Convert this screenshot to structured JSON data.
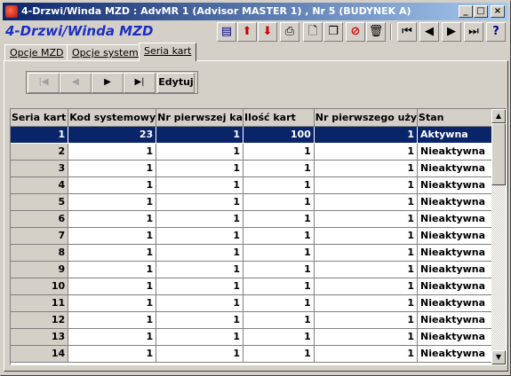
{
  "window": {
    "title": "4-Drzwi/Winda MZD : AdvMR 1 (Advisor MASTER 1) , Nr 5 (BUDYNEK A)",
    "buttons": {
      "minimize": "_",
      "maximize": "□",
      "close": "×"
    }
  },
  "app": {
    "label": "4-Drzwi/Winda MZD"
  },
  "toolbar": {
    "icons": [
      "filter-icon",
      "arrow-up-icon",
      "arrow-down-icon",
      "print-icon",
      "new-document-icon",
      "copy-icon",
      "no-entry-icon",
      "trash-icon",
      "first-record-icon",
      "previous-record-icon",
      "next-record-icon",
      "last-record-icon",
      "help-icon"
    ],
    "glyphs": {
      "up": "⬆",
      "down": "⬇",
      "print": "⎙",
      "new": "🗋",
      "copy": "❐",
      "stop": "⊘",
      "trash": "🗑",
      "first": "⏮",
      "prev": "◀",
      "next": "▶",
      "last": "⏭",
      "help": "?",
      "filter": "▤"
    },
    "colors": {
      "red": "#d40000",
      "navy": "#000080"
    }
  },
  "tabs": [
    {
      "label": "Opcje MZD"
    },
    {
      "label": "Opcje systemu"
    },
    {
      "label": "Seria kart",
      "active": true
    }
  ],
  "nav": {
    "first": "|◀",
    "prev": "◀",
    "next": "▶",
    "last": "▶|",
    "edit": "Edytuj"
  },
  "grid": {
    "columns": [
      "Seria kart",
      "Kod systemowy",
      "Nr pierwszej ka",
      "Ilość kart",
      "Nr pierwszego uży",
      "Stan"
    ],
    "rows": [
      [
        "1",
        "23",
        "1",
        "100",
        "1",
        "Aktywna"
      ],
      [
        "2",
        "1",
        "1",
        "1",
        "1",
        "Nieaktywna"
      ],
      [
        "3",
        "1",
        "1",
        "1",
        "1",
        "Nieaktywna"
      ],
      [
        "4",
        "1",
        "1",
        "1",
        "1",
        "Nieaktywna"
      ],
      [
        "5",
        "1",
        "1",
        "1",
        "1",
        "Nieaktywna"
      ],
      [
        "6",
        "1",
        "1",
        "1",
        "1",
        "Nieaktywna"
      ],
      [
        "7",
        "1",
        "1",
        "1",
        "1",
        "Nieaktywna"
      ],
      [
        "8",
        "1",
        "1",
        "1",
        "1",
        "Nieaktywna"
      ],
      [
        "9",
        "1",
        "1",
        "1",
        "1",
        "Nieaktywna"
      ],
      [
        "10",
        "1",
        "1",
        "1",
        "1",
        "Nieaktywna"
      ],
      [
        "11",
        "1",
        "1",
        "1",
        "1",
        "Nieaktywna"
      ],
      [
        "12",
        "1",
        "1",
        "1",
        "1",
        "Nieaktywna"
      ],
      [
        "13",
        "1",
        "1",
        "1",
        "1",
        "Nieaktywna"
      ],
      [
        "14",
        "1",
        "1",
        "1",
        "1",
        "Nieaktywna"
      ]
    ],
    "selected_row": 0
  },
  "scrollbar": {
    "up": "▲",
    "down": "▼"
  }
}
